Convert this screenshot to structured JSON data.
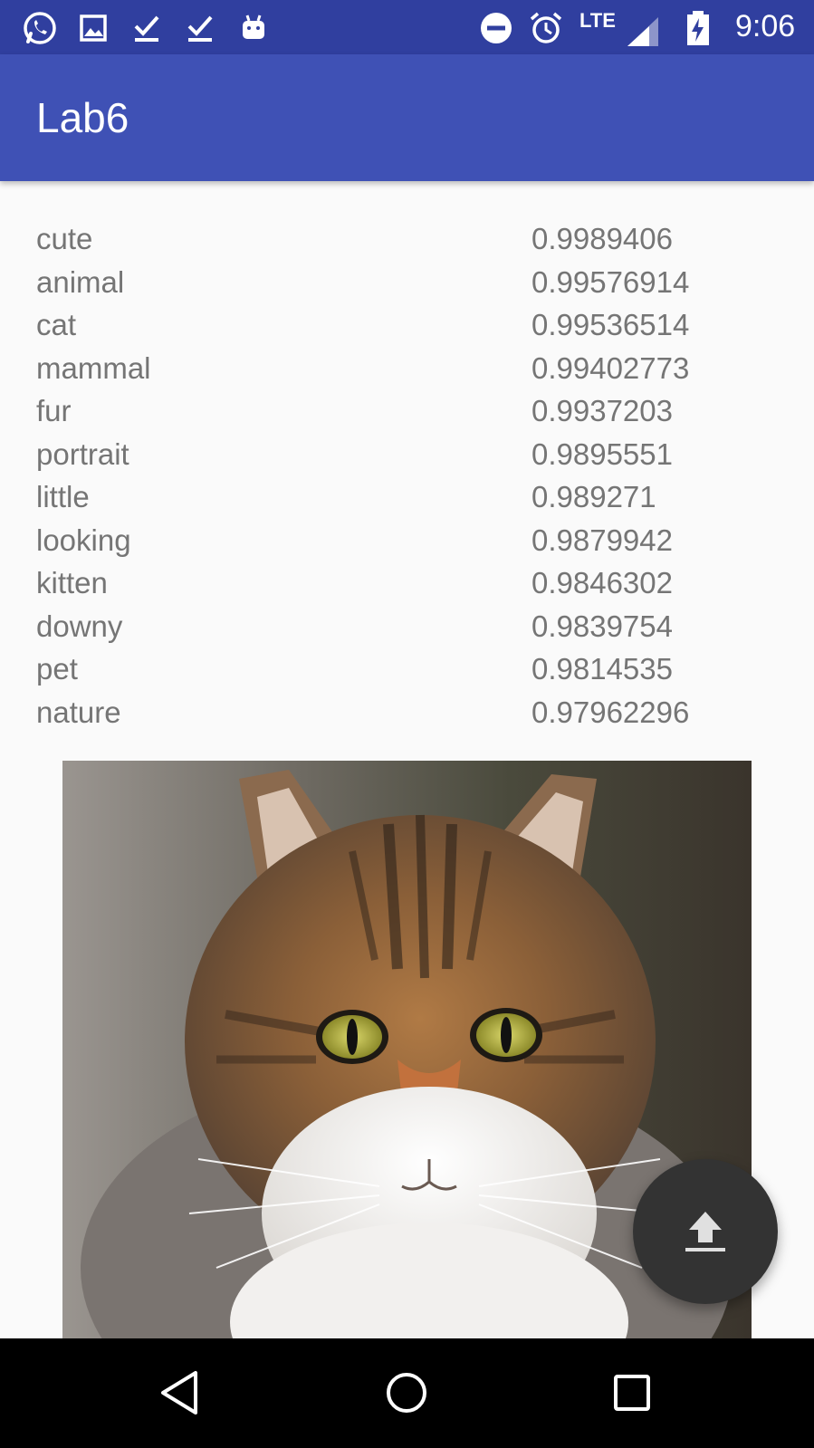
{
  "status_bar": {
    "time": "9:06",
    "network": "LTE",
    "left_icons": [
      "whatsapp-icon",
      "gallery-icon",
      "download-done-icon",
      "download-done-icon",
      "android-icon"
    ],
    "right_icons": [
      "do-not-disturb-icon",
      "alarm-icon",
      "signal-icon",
      "battery-charging-icon"
    ]
  },
  "app_bar": {
    "title": "Lab6"
  },
  "labels": [
    {
      "tag": "cute",
      "score": "0.9989406"
    },
    {
      "tag": "animal",
      "score": "0.99576914"
    },
    {
      "tag": "cat",
      "score": "0.99536514"
    },
    {
      "tag": "mammal",
      "score": "0.99402773"
    },
    {
      "tag": "fur",
      "score": "0.9937203"
    },
    {
      "tag": "portrait",
      "score": "0.9895551"
    },
    {
      "tag": "little",
      "score": "0.989271"
    },
    {
      "tag": "looking",
      "score": "0.9879942"
    },
    {
      "tag": "kitten",
      "score": "0.9846302"
    },
    {
      "tag": "downy",
      "score": "0.9839754"
    },
    {
      "tag": "pet",
      "score": "0.9814535"
    },
    {
      "tag": "nature",
      "score": "0.97962296"
    }
  ],
  "photo": {
    "subject": "tabby cat portrait"
  },
  "fab": {
    "icon": "upload-icon"
  },
  "nav_bar": {
    "buttons": [
      "back-icon",
      "home-icon",
      "recents-icon"
    ]
  },
  "colors": {
    "status_bar": "#303f9f",
    "app_bar": "#3f51b5",
    "background": "#fafafa",
    "text": "#757575",
    "fab": "#333333",
    "nav_bar": "#000000"
  }
}
